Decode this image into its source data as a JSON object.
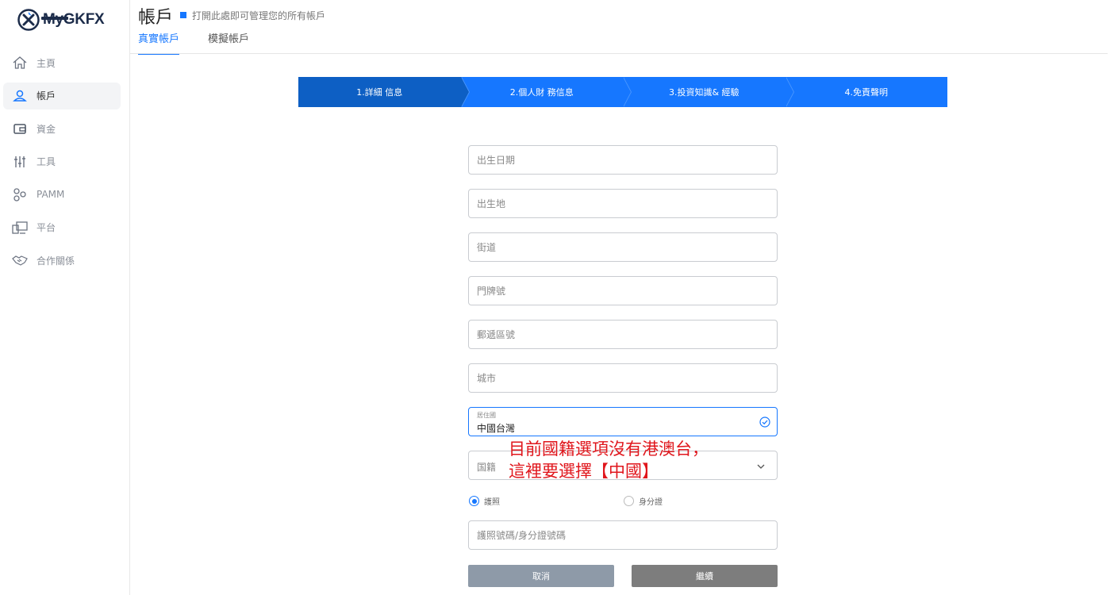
{
  "brand": {
    "name": "MyGKFX"
  },
  "sidebar": {
    "items": [
      {
        "label": "主頁",
        "icon": "home-icon"
      },
      {
        "label": "帳戶",
        "icon": "user-icon"
      },
      {
        "label": "資金",
        "icon": "wallet-icon"
      },
      {
        "label": "工具",
        "icon": "sliders-icon"
      },
      {
        "label": "PAMM",
        "icon": "pamm-icon"
      },
      {
        "label": "平台",
        "icon": "platform-icon"
      },
      {
        "label": "合作關係",
        "icon": "handshake-icon"
      }
    ],
    "active_index": 1
  },
  "header": {
    "title": "帳戶",
    "description": "打開此處即可管理您的所有帳戶",
    "tabs": [
      {
        "label": "真實帳戶",
        "active": true
      },
      {
        "label": "模擬帳戶",
        "active": false
      }
    ]
  },
  "stepper": {
    "steps": [
      "1.詳細 信息",
      "2.個人財 務信息",
      "3.投資知識& 經驗",
      "4.免責聲明"
    ],
    "active_index": 0
  },
  "form": {
    "birth_date": {
      "placeholder": "出生日期"
    },
    "birth_place": {
      "placeholder": "出生地"
    },
    "street": {
      "placeholder": "街道"
    },
    "house_number": {
      "placeholder": "門牌號"
    },
    "postal_code": {
      "placeholder": "郵遞區號"
    },
    "city": {
      "placeholder": "城市"
    },
    "residence_country": {
      "label": "居住國",
      "value": "中國台灣"
    },
    "nationality": {
      "placeholder": "国籍"
    },
    "id_type": {
      "options": [
        {
          "label": "護照",
          "selected": true
        },
        {
          "label": "身分證",
          "selected": false
        }
      ]
    },
    "id_number": {
      "placeholder": "護照號碼/身分證號碼"
    },
    "cancel_label": "取消",
    "continue_label": "繼續"
  },
  "annotation": {
    "line1": "目前國籍選項沒有港澳台，",
    "line2": "這裡要選擇【中國】"
  },
  "colors": {
    "accent": "#1677ff",
    "active_step": "#0d5fc4",
    "annotation": "#e0161c",
    "cancel_button": "#8e9aa8",
    "continue_button": "#7d7d7d"
  }
}
